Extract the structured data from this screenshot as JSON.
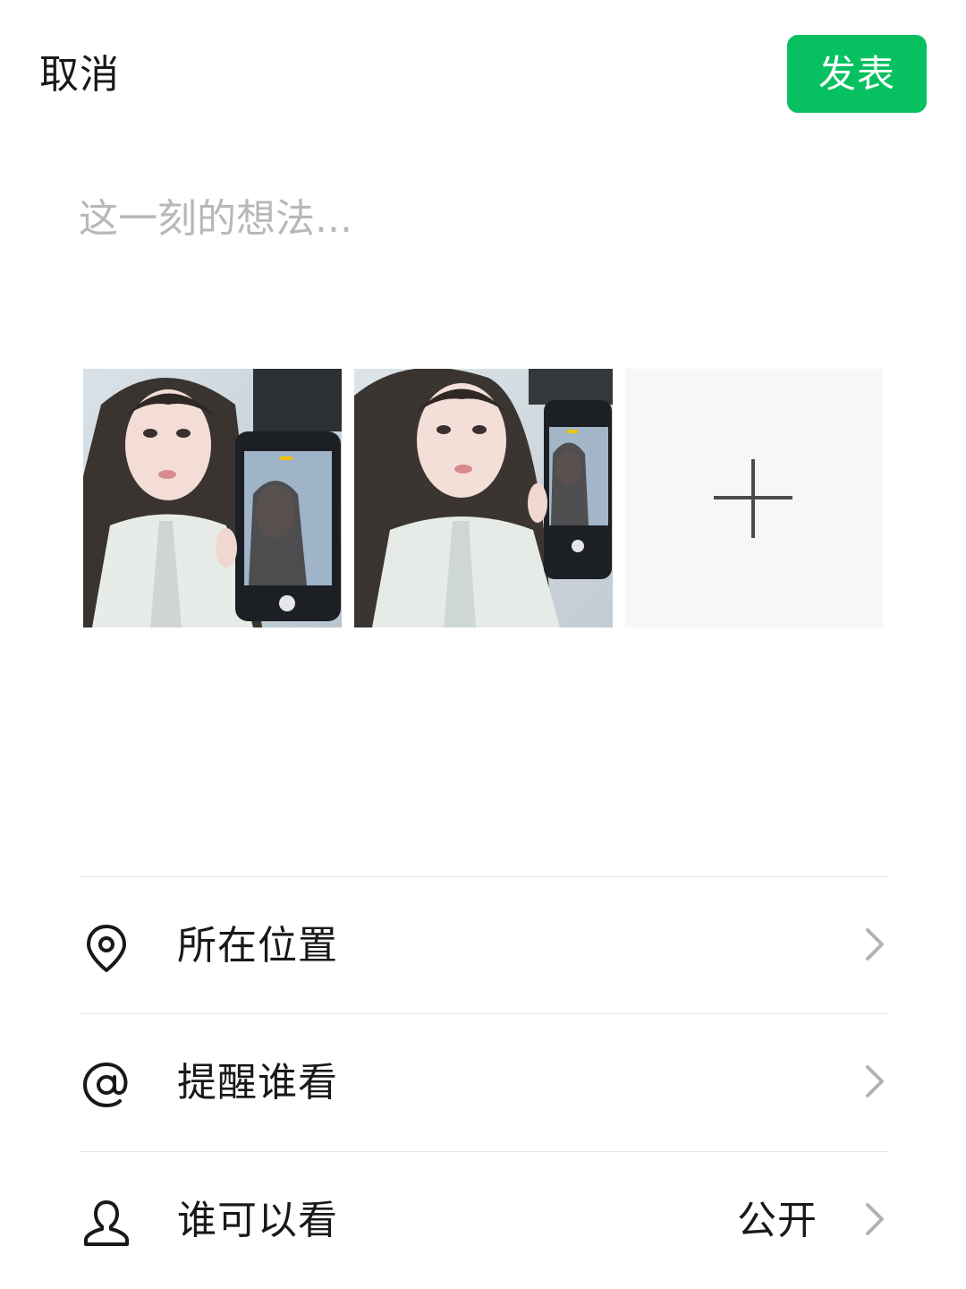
{
  "header": {
    "cancel_label": "取消",
    "publish_label": "发表",
    "publish_color": "#07c160"
  },
  "composer": {
    "placeholder": "这一刻的想法...",
    "value": ""
  },
  "photos": {
    "items": [
      {
        "description": "selfie-with-phone"
      },
      {
        "description": "selfie-with-phone"
      }
    ],
    "add_icon": "plus-icon"
  },
  "settings": {
    "items": [
      {
        "icon": "location-pin-icon",
        "label": "所在位置",
        "value": ""
      },
      {
        "icon": "at-sign-icon",
        "label": "提醒谁看",
        "value": ""
      },
      {
        "icon": "person-icon",
        "label": "谁可以看",
        "value": "公开"
      }
    ]
  }
}
